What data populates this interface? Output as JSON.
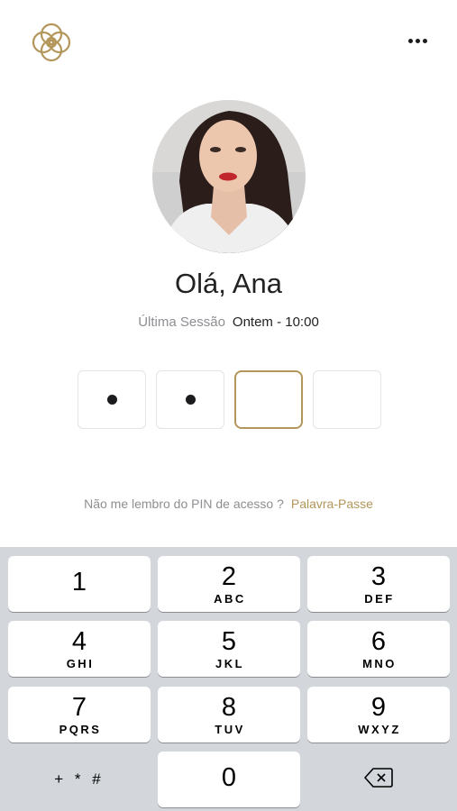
{
  "header": {
    "logo_icon": "interlaced-knot-logo-icon",
    "more_icon": "more-options-icon"
  },
  "profile": {
    "greeting": "Olá, Ana",
    "last_session_label": "Última Sessão",
    "last_session_value": "Ontem - 10:00"
  },
  "pin": {
    "length": 4,
    "entered": 2
  },
  "forgot": {
    "question": "Não me lembro do PIN de acesso ?",
    "link": "Palavra-Passe"
  },
  "keypad": {
    "keys": [
      {
        "num": "1",
        "letters": ""
      },
      {
        "num": "2",
        "letters": "ABC"
      },
      {
        "num": "3",
        "letters": "DEF"
      },
      {
        "num": "4",
        "letters": "GHI"
      },
      {
        "num": "5",
        "letters": "JKL"
      },
      {
        "num": "6",
        "letters": "MNO"
      },
      {
        "num": "7",
        "letters": "PQRS"
      },
      {
        "num": "8",
        "letters": "TUV"
      },
      {
        "num": "9",
        "letters": "WXYZ"
      }
    ],
    "symbols": "+ * #",
    "zero": "0",
    "backspace_icon": "backspace-icon"
  },
  "colors": {
    "accent": "#b3965a",
    "keypad_bg": "#d3d6db"
  }
}
